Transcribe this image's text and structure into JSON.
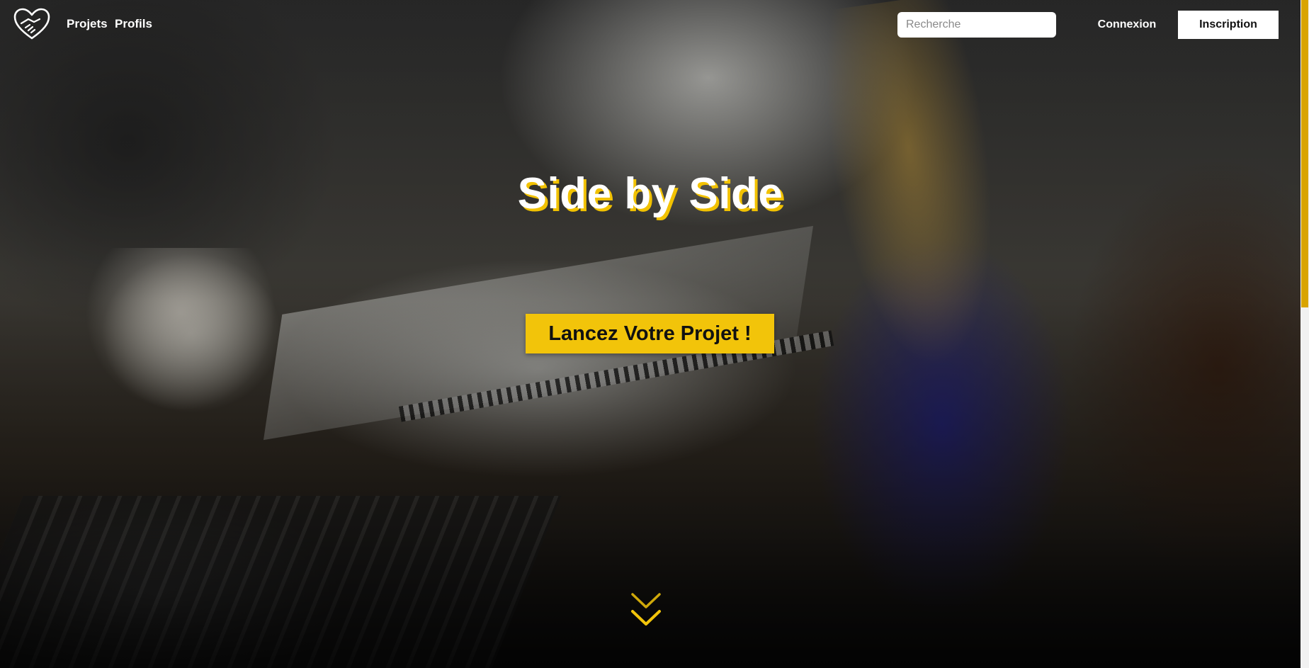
{
  "nav": {
    "logo": "handshake-heart-logo",
    "links": [
      {
        "label": "Projets"
      },
      {
        "label": "Profils"
      }
    ],
    "search": {
      "placeholder": "Recherche",
      "value": ""
    },
    "login_label": "Connexion",
    "signup_label": "Inscription"
  },
  "hero": {
    "title": "Side by Side",
    "cta_label": "Lancez Votre Projet !",
    "scroll_icon": "double-chevron-down-icon"
  },
  "colors": {
    "accent": "#f2c40a",
    "text": "#ffffff",
    "signup_bg": "#ffffff"
  }
}
